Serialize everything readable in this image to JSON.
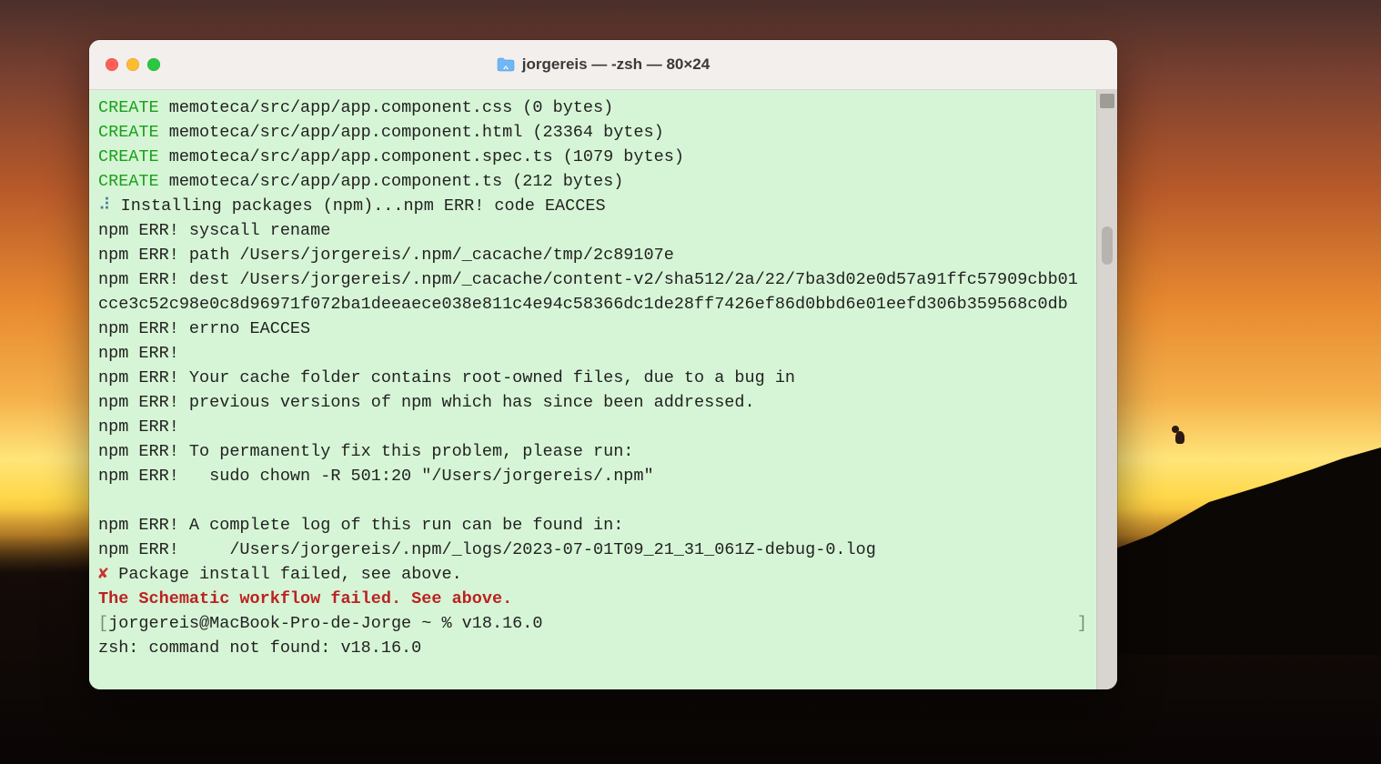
{
  "window": {
    "title": "jorgereis — -zsh — 80×24",
    "folder_icon_name": "home-folder-icon"
  },
  "terminal": {
    "create_word": "CREATE",
    "lines": {
      "l1_path": " memoteca/src/app/app.component.css (0 bytes)",
      "l2_path": " memoteca/src/app/app.component.html (23364 bytes)",
      "l3_path": " memoteca/src/app/app.component.spec.ts (1079 bytes)",
      "l4_path": " memoteca/src/app/app.component.ts (212 bytes)",
      "spinner": "⠼",
      "l5": " Installing packages (npm)...npm ERR! code EACCES",
      "l6": "npm ERR! syscall rename",
      "l7": "npm ERR! path /Users/jorgereis/.npm/_cacache/tmp/2c89107e",
      "l8": "npm ERR! dest /Users/jorgereis/.npm/_cacache/content-v2/sha512/2a/22/7ba3d02e0d57a91ffc57909cbb01cce3c52c98e0c8d96971f072ba1deeaece038e811c4e94c58366dc1de28ff7426ef86d0bbd6e01eefd306b359568c0db",
      "l9": "npm ERR! errno EACCES",
      "l10": "npm ERR! ",
      "l11": "npm ERR! Your cache folder contains root-owned files, due to a bug in",
      "l12": "npm ERR! previous versions of npm which has since been addressed.",
      "l13": "npm ERR! ",
      "l14": "npm ERR! To permanently fix this problem, please run:",
      "l15": "npm ERR!   sudo chown -R 501:20 \"/Users/jorgereis/.npm\"",
      "blank": "",
      "l16": "npm ERR! A complete log of this run can be found in:",
      "l17": "npm ERR!     /Users/jorgereis/.npm/_logs/2023-07-01T09_21_31_061Z-debug-0.log",
      "xmark": "✘",
      "l18": " Package install failed, see above.",
      "l19": "The Schematic workflow failed. See above.",
      "prompt_open": "[",
      "prompt": "jorgereis@MacBook-Pro-de-Jorge ~ % v18.16.0",
      "prompt_close": "]",
      "l20": "zsh: command not found: v18.16.0"
    }
  }
}
